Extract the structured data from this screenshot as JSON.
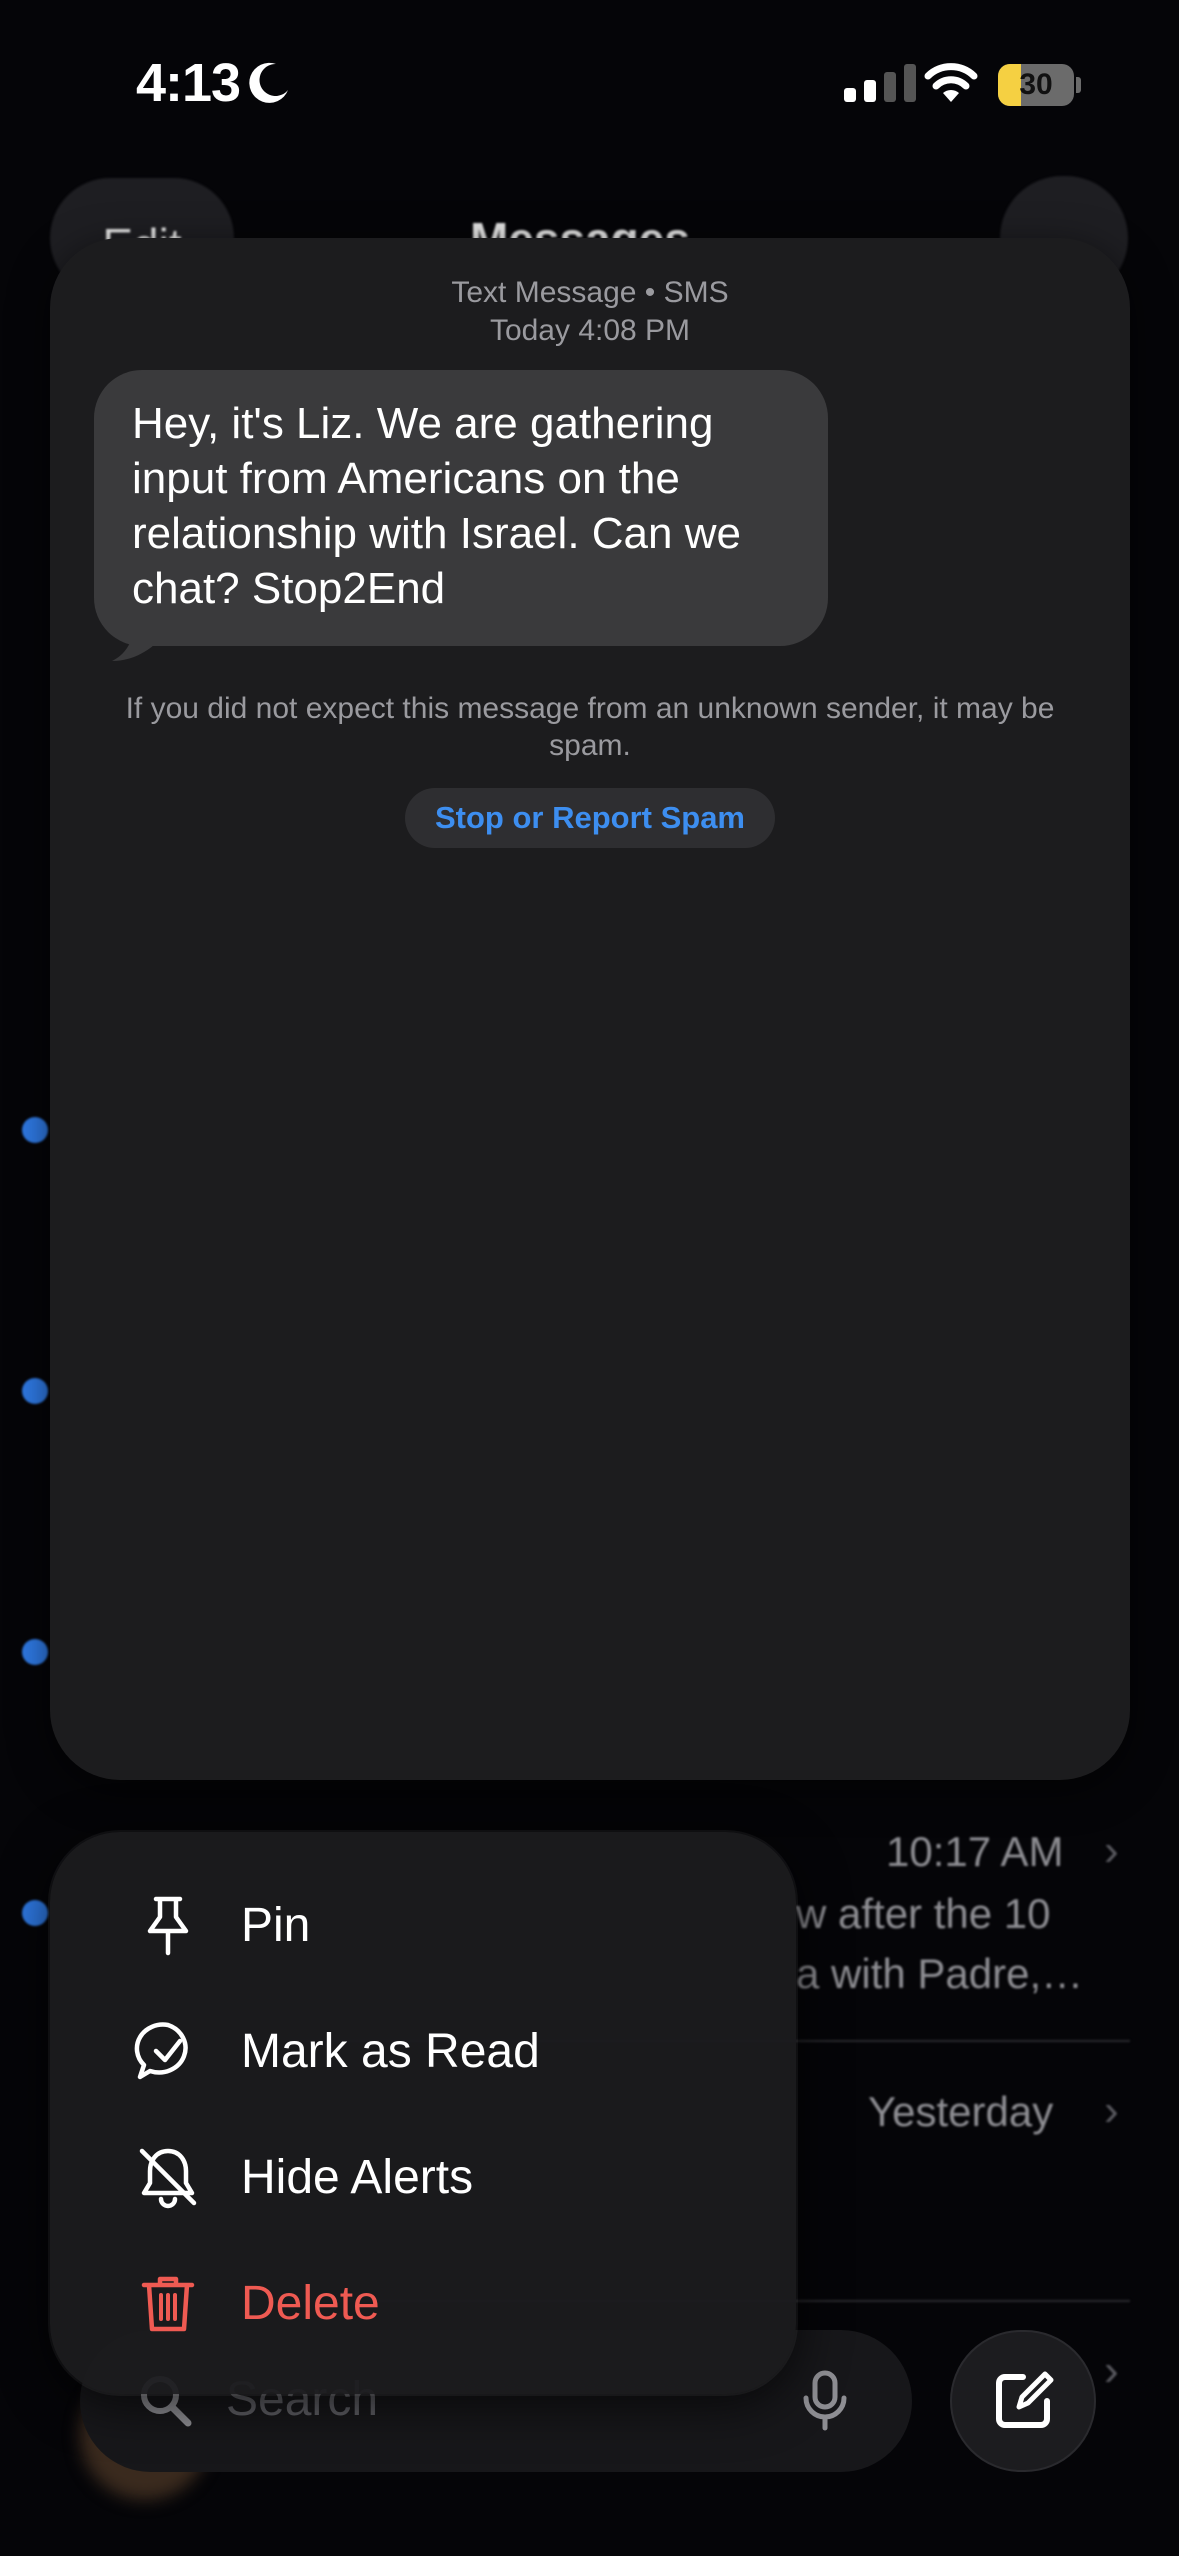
{
  "status": {
    "time": "4:13",
    "battery": "30",
    "battery_level": 0.3
  },
  "background": {
    "edit_label": "Edit",
    "title": "Messages",
    "rows": [
      {
        "time": "10:17 AM",
        "preview_line1": "w after the 10",
        "preview_line2": "a with Padre,…"
      },
      {
        "time": "Yesterday"
      }
    ]
  },
  "preview": {
    "header_line1": "Text Message • SMS",
    "header_line2": "Today 4:08 PM",
    "message": "Hey, it's Liz. We are gathering input from Americans on the relationship with Israel. Can we chat? Stop2End",
    "spam_notice": "If you did not expect this message from an unknown sender, it may be spam.",
    "spam_button": "Stop or Report Spam"
  },
  "menu": {
    "items": [
      {
        "label": "Pin",
        "icon": "pin-icon"
      },
      {
        "label": "Mark as Read",
        "icon": "chat-check-icon"
      },
      {
        "label": "Hide Alerts",
        "icon": "bell-slash-icon"
      },
      {
        "label": "Delete",
        "icon": "trash-icon"
      }
    ]
  },
  "bottom": {
    "search_placeholder": "Search"
  },
  "colors": {
    "accent_blue": "#3d8ef0",
    "unread_dot": "#2f7ae5",
    "destructive": "#ef5a52",
    "battery": "#f5d042"
  }
}
